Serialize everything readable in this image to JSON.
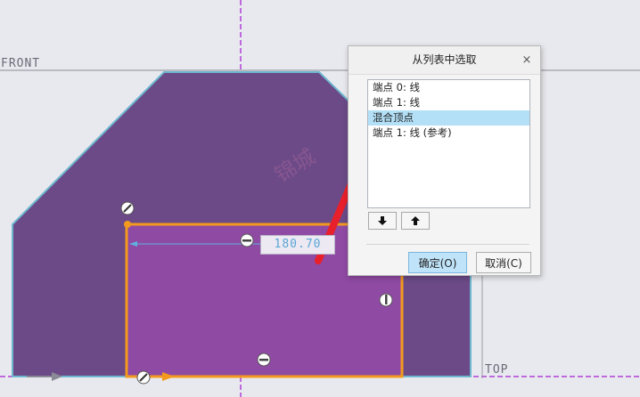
{
  "datums": {
    "front": "FRONT",
    "top": "TOP"
  },
  "dimension": {
    "value": "180.70"
  },
  "dialog": {
    "title": "从列表中选取",
    "close_glyph": "×",
    "items": [
      "端点 0: 线",
      "端点 1: 线",
      "混合顶点",
      "端点 1: 线 (参考)"
    ],
    "selected_index": 2,
    "move_down_glyph": "🡇",
    "move_up_glyph": "🡅",
    "ok_label": "确定(O)",
    "cancel_label": "取消(C)"
  },
  "watermark": "锦城",
  "colors": {
    "background": "#e8e9ee",
    "outer_shape": "#6b4a87",
    "inner_rect": "#8f4aa3",
    "selection_orange": "#f39a1e",
    "datum_magenta": "#b040d6",
    "arrow_red": "#e8202b"
  }
}
